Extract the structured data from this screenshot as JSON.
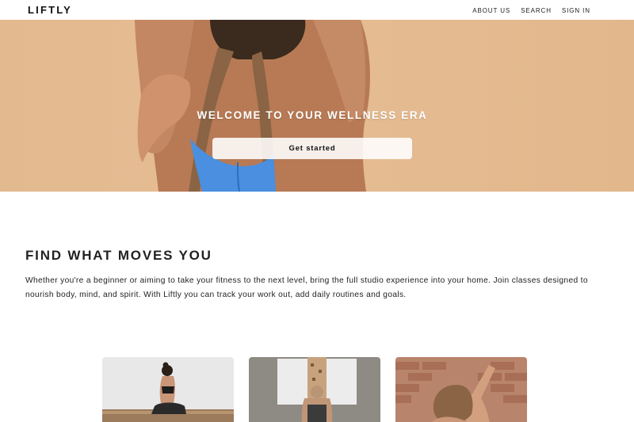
{
  "header": {
    "logo": "LIFTLY",
    "nav": [
      "ABOUT US",
      "SEARCH",
      "SIGN IN"
    ]
  },
  "hero": {
    "title": "WELCOME TO YOUR WELLNESS ERA",
    "cta_label": "Get started",
    "background_color": "#e4ba90"
  },
  "intro": {
    "title": "FIND WHAT MOVES YOU",
    "body": "Whether you're a beginner or aiming to take your fitness to the next level, bring the full studio experience into your home. Join classes designed to nourish body, mind, and spirit. With Liftly you can track your work out, add daily routines and goals."
  },
  "cards": [
    {
      "image": "seated-yoga-photo"
    },
    {
      "image": "wall-workout-photo"
    },
    {
      "image": "brick-wall-stretch-photo"
    }
  ]
}
